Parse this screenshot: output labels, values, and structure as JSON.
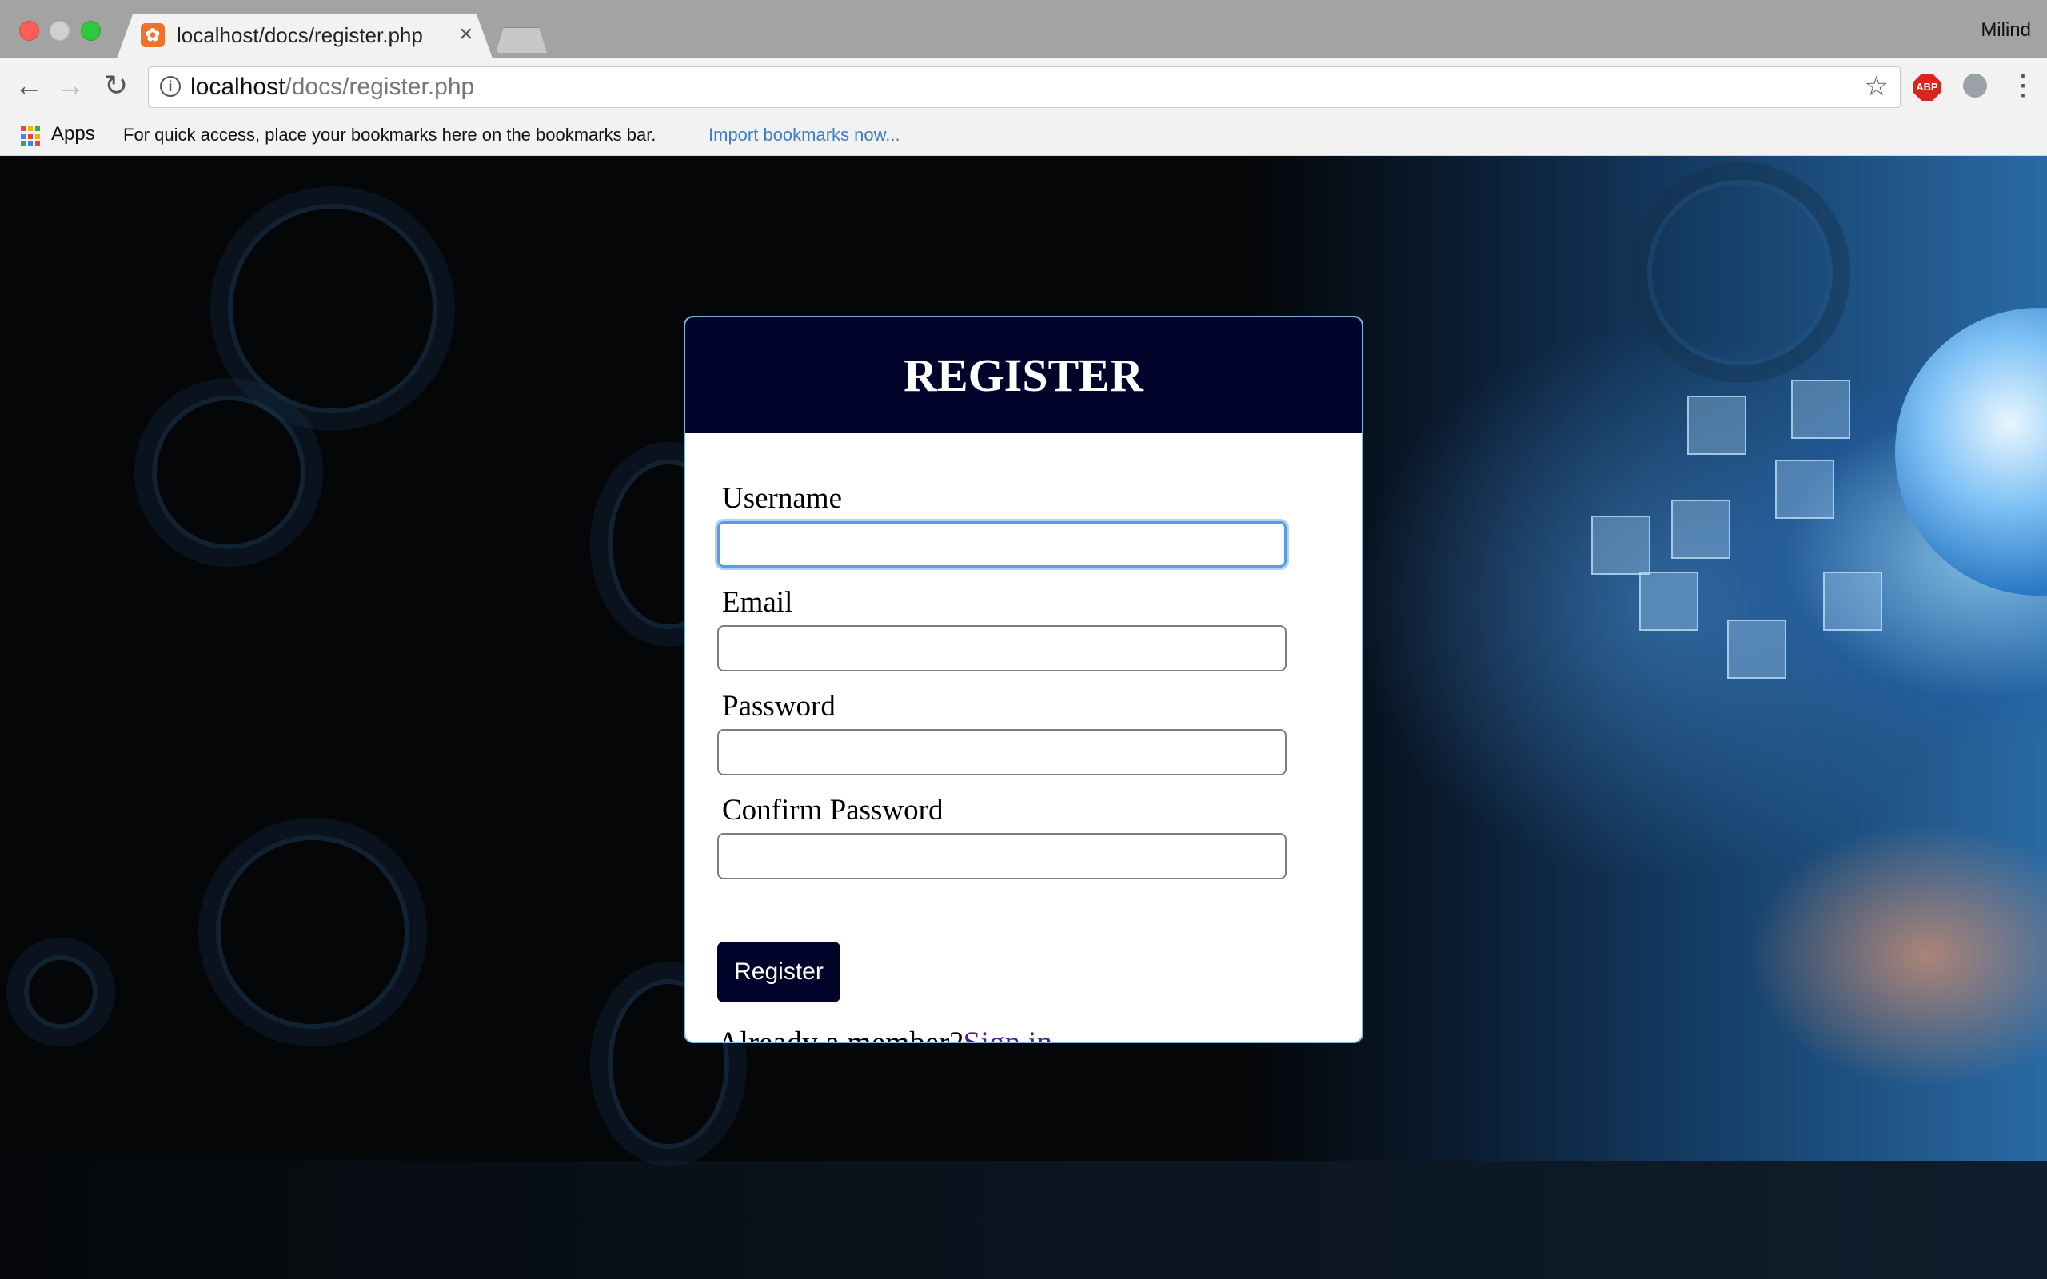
{
  "browser": {
    "tab_title": "localhost/docs/register.php",
    "tab_favicon": "xampp-icon",
    "profile_name": "Milind",
    "url_host": "localhost",
    "url_path": "/docs/register.php",
    "apps_label": "Apps",
    "bookmarks_hint": "For quick access, place your bookmarks here on the bookmarks bar.",
    "bookmarks_import": "Import bookmarks now...",
    "abp_label": "ABP"
  },
  "form": {
    "title": "REGISTER",
    "fields": [
      {
        "label": "Username",
        "value": "",
        "focused": true
      },
      {
        "label": "Email",
        "value": ""
      },
      {
        "label": "Password",
        "value": ""
      },
      {
        "label": "Confirm Password",
        "value": ""
      }
    ],
    "submit_label": "Register",
    "member_text": "Already a member?",
    "signin_label": "Sign in"
  },
  "colors": {
    "header_bg": "#02032a",
    "link": "#551a8b",
    "focus": "#5a9be6"
  }
}
